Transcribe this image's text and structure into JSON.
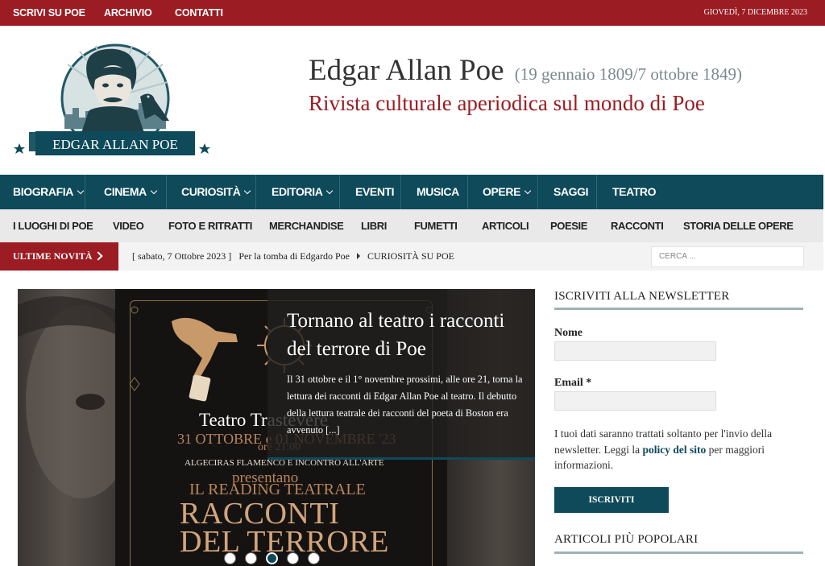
{
  "topbar": {
    "links": [
      "SCRIVI SU POE",
      "ARCHIVIO",
      "CONTATTI"
    ],
    "date": "GIOVEDÌ, 7 DICEMBRE 2023"
  },
  "header": {
    "logo_text": "EDGAR ALLAN POE",
    "title": "Edgar Allan Poe",
    "dates": "(19 gennaio 1809/7 ottobre 1849)",
    "tagline": "Rivista culturale aperiodica sul mondo di Poe"
  },
  "main_nav": [
    {
      "label": "BIOGRAFIA",
      "dropdown": true
    },
    {
      "label": "CINEMA",
      "dropdown": true
    },
    {
      "label": "CURIOSITÀ",
      "dropdown": true
    },
    {
      "label": "EDITORIA",
      "dropdown": true
    },
    {
      "label": "EVENTI",
      "dropdown": false
    },
    {
      "label": "MUSICA",
      "dropdown": false
    },
    {
      "label": "OPERE",
      "dropdown": true
    },
    {
      "label": "SAGGI",
      "dropdown": false
    },
    {
      "label": "TEATRO",
      "dropdown": false
    }
  ],
  "sub_nav": [
    "I LUOGHI DI POE",
    "VIDEO",
    "FOTO E RITRATTI",
    "MERCHANDISE",
    "LIBRI",
    "FUMETTI",
    "ARTICOLI",
    "POESIE",
    "RACCONTI",
    "STORIA DELLE OPERE"
  ],
  "ticker": {
    "label": "ULTIME NOVITÀ",
    "date": "[ sabato, 7 Ottobre 2023 ]",
    "headline": "Per la tomba di Edgardo Poe",
    "category": "CURIOSITÀ SU POE"
  },
  "search": {
    "placeholder": "CERCA ..."
  },
  "slider": {
    "title": "Tornano al teatro i racconti del terrore di Poe",
    "excerpt": "Il 31 ottobre e il 1° novembre prossimi, alle ore 21, torna la lettura dei racconti di Edgar Allan Poe al teatro. Il debutto della lettura teatrale dei racconti del poeta di Boston era avvenuto [...]",
    "poster": {
      "venue": "Teatro Trastevere",
      "dates": "31 OTTOBRE e 01 NOVEMBRE '23",
      "time": "ore 21:00",
      "organizers": "ALGECIRAS FLAMENCO E INCONTRO ALL'ARTE",
      "presents": "presentano",
      "reading": "IL READING TEATRALE",
      "show_line1": "RACCONTI",
      "show_line2": "DEL TERRORE"
    },
    "slide_count": 5,
    "active_slide": 3
  },
  "sidebar": {
    "newsletter_heading": "ISCRIVITI ALLA NEWSLETTER",
    "name_label": "Nome",
    "email_label": "Email *",
    "privacy_text_before": "I tuoi dati saranno trattati soltanto per l'invio della newsletter. Leggi la ",
    "privacy_link": "policy del sito",
    "privacy_text_after": " per maggiori informazioni.",
    "subscribe_label": "ISCRIVITI",
    "popular_heading": "ARTICOLI PIÙ POPOLARI"
  },
  "colors": {
    "brand_red": "#9b1c22",
    "brand_teal": "#0e4a59"
  }
}
